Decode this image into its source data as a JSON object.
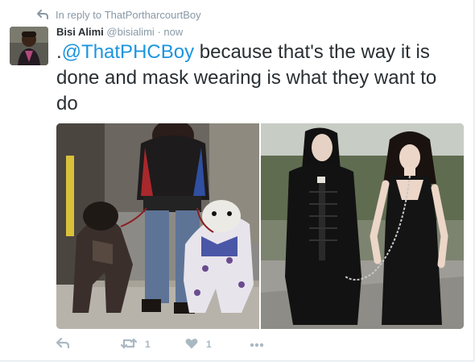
{
  "reply_context": {
    "prefix": "In reply to",
    "target": "ThatPortharcourtBoy"
  },
  "author": {
    "name": "Bisi Alimi",
    "handle": "@bisialimi",
    "separator": "·",
    "time": "now"
  },
  "tweet": {
    "prefix": ".",
    "mention": "@ThatPHCBoy",
    "body": " because that's the way it is done and mask wearing is what they want to do"
  },
  "actions": {
    "reply_icon": "reply-icon",
    "retweet_icon": "retweet-icon",
    "retweet_count": "1",
    "like_icon": "heart-icon",
    "like_count": "1",
    "more_icon": "more-icon"
  },
  "colors": {
    "accent": "#1b95e0",
    "muted": "#8899a6",
    "text": "#292f33",
    "action_gray": "#aab8c2"
  }
}
